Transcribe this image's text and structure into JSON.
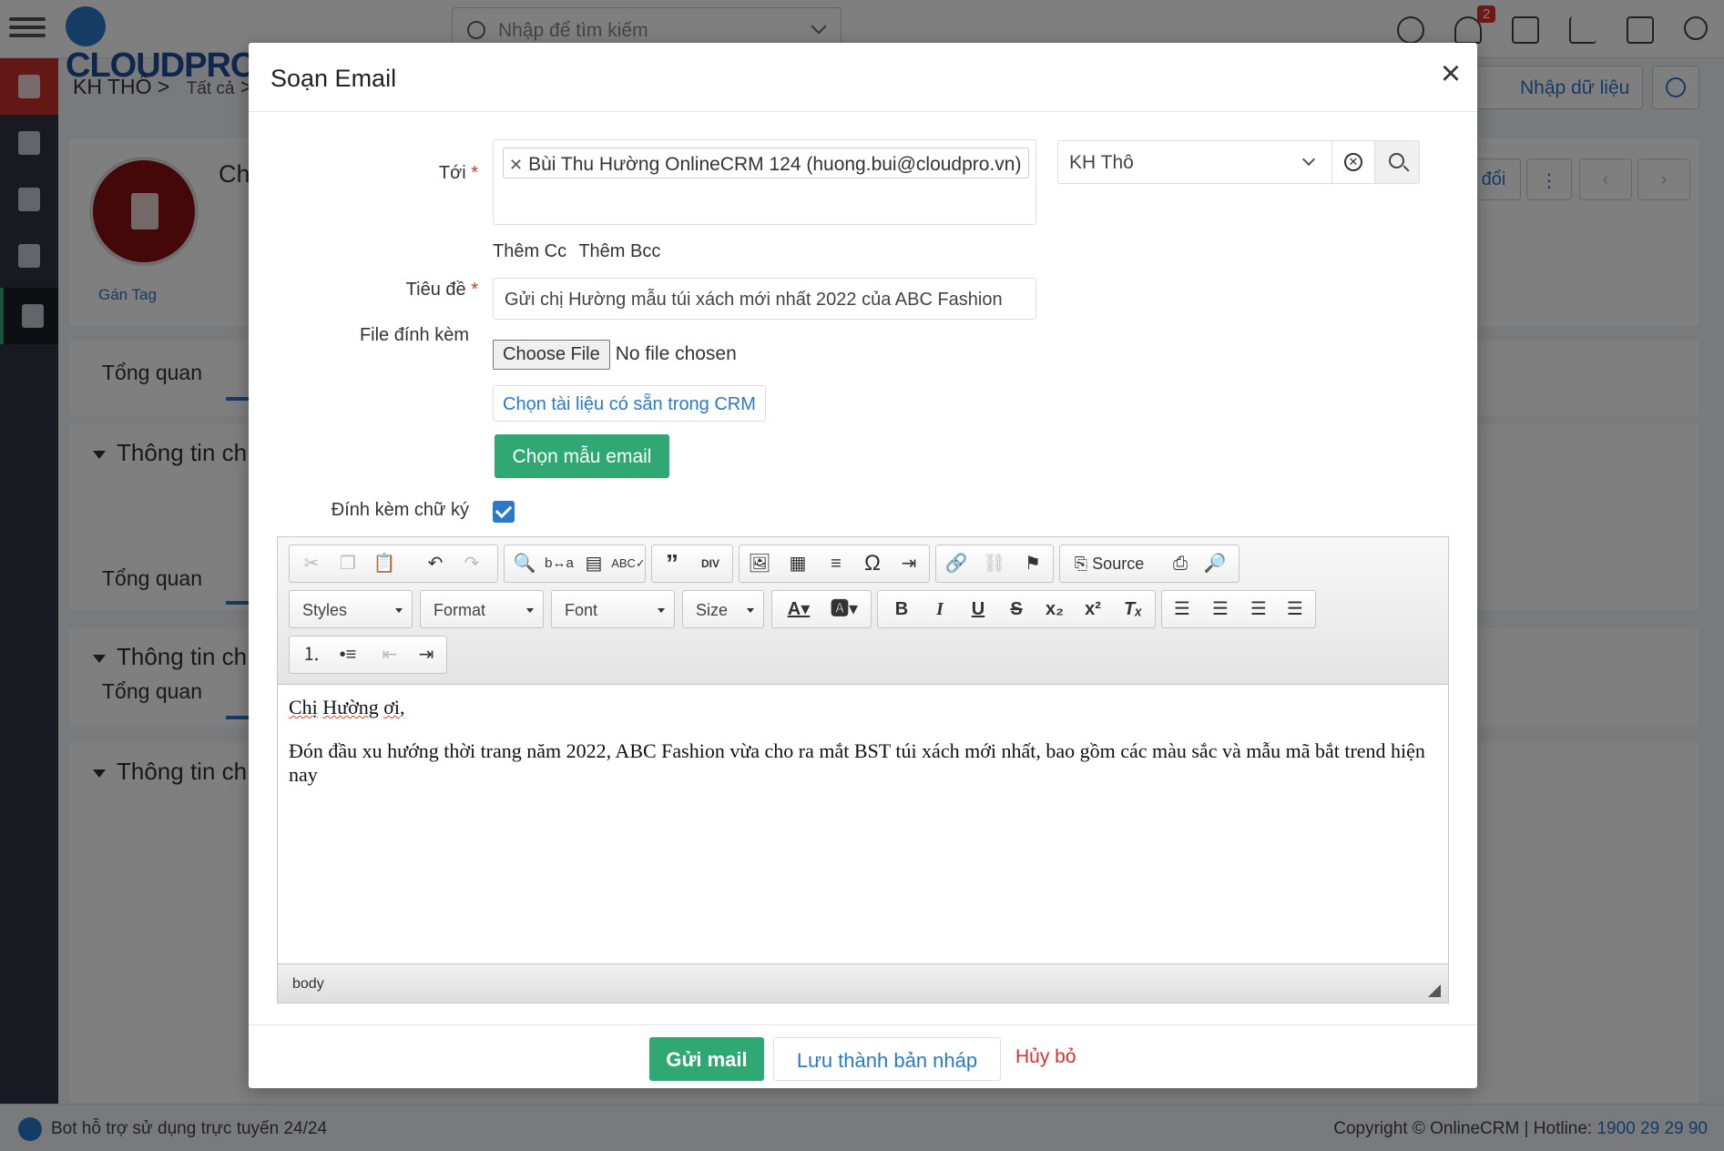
{
  "topbar": {
    "logo": "CLOUDPRO",
    "search_placeholder": "Nhập để tìm kiếm",
    "notification_count": "2"
  },
  "page": {
    "breadcrumb_module": "KH THÔ",
    "breadcrumb_filter": "Tất cả",
    "import_label": "Nhập dữ liệu",
    "record_name_partial": "Ch",
    "tag_label": "Gán Tag",
    "tab_overview": "Tổng quan",
    "section_info": "Thông tin ch",
    "convert_label": "đổi"
  },
  "modal": {
    "title": "Soạn Email",
    "to_label": "Tới",
    "to_recipient": "Bùi Thu Hường OnlineCRM 124 (huong.bui@cloudpro.vn)",
    "module_select": "KH Thô",
    "add_cc": "Thêm Cc",
    "add_bcc": "Thêm Bcc",
    "subject_label": "Tiêu đề",
    "subject_value": "Gửi chị Hường mẫu túi xách mới nhất 2022 của ABC Fashion",
    "attach_label": "File đính kèm",
    "choose_file": "Choose File",
    "no_file": "No file chosen",
    "crm_doc_link": "Chọn tài liệu có sẵn trong CRM",
    "template_button": "Chọn mẫu email",
    "signature_label": "Đính kèm chữ ký",
    "signature_checked": true,
    "toolbar": {
      "source": "Source",
      "styles": "Styles",
      "format": "Format",
      "font": "Font",
      "size": "Size"
    },
    "body_line1_words": [
      "Chị",
      "Hường",
      "ơi,"
    ],
    "body_line2": "Đón đầu xu hướng thời trang năm 2022, ABC Fashion vừa cho ra mắt BST túi xách mới nhất, bao gồm các màu sắc và mẫu mã bắt trend hiện nay",
    "status_path": "body",
    "send_button": "Gửi mail",
    "draft_button": "Lưu thành bản nháp",
    "cancel_button": "Hủy bỏ"
  },
  "footer": {
    "bot_text": "Bot hỗ trợ sử dụng trực tuyến 24/24",
    "copyright": "Copyright © OnlineCRM | Hotline:",
    "hotline": "1900 29 29 90"
  },
  "colors": {
    "primary": "#2b79c9",
    "success": "#2fa873",
    "danger": "#d9302c",
    "rail": "#2e3440"
  }
}
